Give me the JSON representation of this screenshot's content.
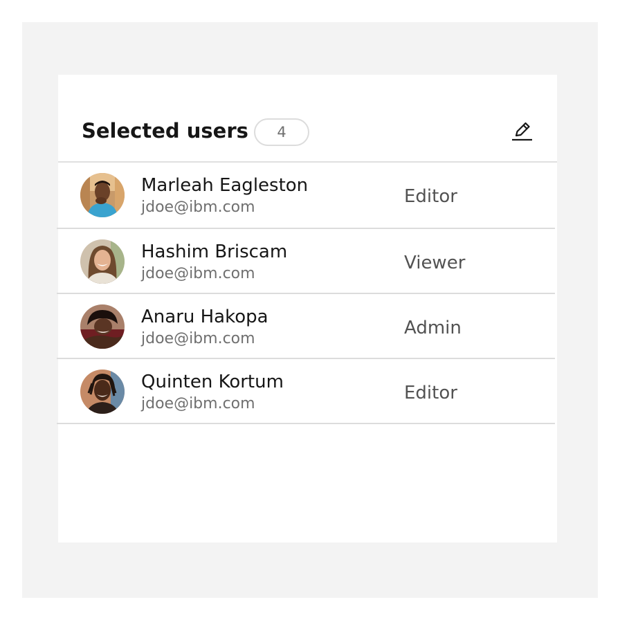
{
  "header": {
    "title": "Selected users",
    "count": "4",
    "edit_icon": "pencil-edit-icon"
  },
  "users": [
    {
      "name": "Marleah Eagleston",
      "email": "jdoe@ibm.com",
      "role": "Editor",
      "avatar_icon": "avatar-photo-icon"
    },
    {
      "name": "Hashim Briscam",
      "email": "jdoe@ibm.com",
      "role": "Viewer",
      "avatar_icon": "avatar-photo-icon"
    },
    {
      "name": "Anaru Hakopa",
      "email": "jdoe@ibm.com",
      "role": "Admin",
      "avatar_icon": "avatar-photo-icon"
    },
    {
      "name": "Quinten Kortum",
      "email": "jdoe@ibm.com",
      "role": "Editor",
      "avatar_icon": "avatar-photo-icon"
    }
  ],
  "colors": {
    "background_frame": "#f3f3f3",
    "panel": "#ffffff",
    "text_primary": "#161616",
    "text_secondary": "#6f6f6f",
    "divider": "#dcdcdc"
  }
}
